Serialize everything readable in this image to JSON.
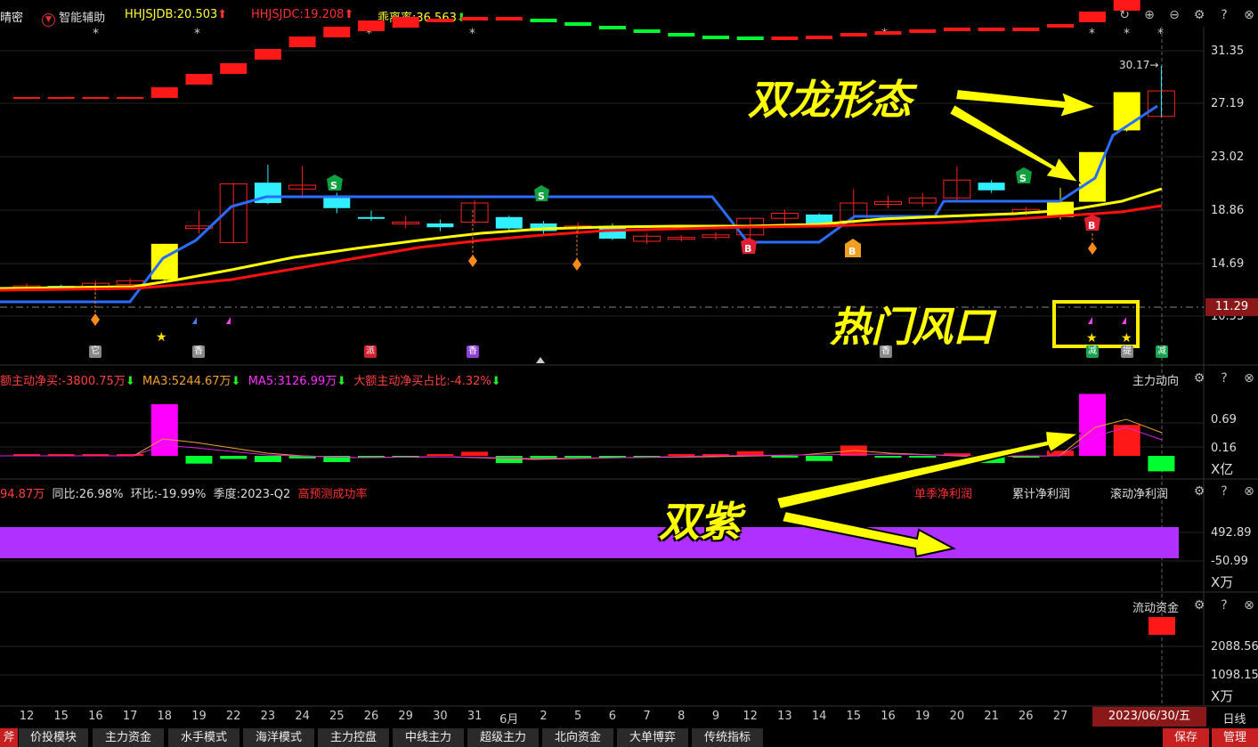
{
  "header": {
    "stock_name": "晴密",
    "assist_label": "智能辅助",
    "hhjsjdb": "HHJSJDB:20.503",
    "hhjsjdc": "HHJSJDC:19.208",
    "guaililv": "乖离率:36.563"
  },
  "main_chart": {
    "peak_label": "30.17",
    "current_price": "11.29",
    "yticks": [
      "31.35",
      "27.19",
      "23.02",
      "18.86",
      "14.69",
      "10.53"
    ]
  },
  "panel2": {
    "title_main": "额主动净买:-3800.75万",
    "title_ma3": "MA3:5244.67万",
    "title_ma5": "MA5:3126.99万",
    "title_ratio": "大额主动净买占比:-4.32%",
    "name": "主力动向",
    "yticks": [
      "0.69",
      "0.16"
    ],
    "unit": "X亿"
  },
  "panel3": {
    "title_value": "94.87万",
    "title_yoy": "同比:26.98%",
    "title_qoq": "环比:-19.99%",
    "title_quarter": "季度:2023-Q2",
    "title_rate": "高预测成功率",
    "tab_single": "单季净利润",
    "tab_cumulative": "累计净利润",
    "tab_rolling": "滚动净利润",
    "yticks": [
      "492.89",
      "-50.99"
    ],
    "unit": "X万"
  },
  "panel4": {
    "name": "流动资金",
    "yticks": [
      "2088.56",
      "1098.15"
    ],
    "unit": "X万"
  },
  "xaxis": {
    "ticks": [
      "12",
      "15",
      "16",
      "17",
      "18",
      "19",
      "22",
      "23",
      "24",
      "25",
      "26",
      "29",
      "30",
      "31",
      "6月",
      "2",
      "5",
      "6",
      "7",
      "8",
      "9",
      "12",
      "13",
      "14",
      "15",
      "16",
      "19",
      "20",
      "21",
      "26",
      "27"
    ],
    "date_label": "2023/06/30/五",
    "period_label": "日线"
  },
  "annotations": {
    "double_dragon": "双龙形态",
    "hot_wind": "热门风口",
    "double_purple": "双紫"
  },
  "signal_tags": {
    "t1": "它",
    "t2": "香",
    "t3": "派",
    "t4": "香",
    "t5": "香",
    "t6": "减",
    "t7": "提",
    "t8": "减"
  },
  "bottom_tabs": [
    "斧",
    "价投模块",
    "主力资金",
    "水手模式",
    "海洋模式",
    "主力控盘",
    "中线主力",
    "超级主力",
    "北向资金",
    "大单博弈",
    "传统指标"
  ],
  "bottom_buttons": {
    "save": "保存",
    "manage": "管理"
  },
  "colors": {
    "up": "#ff2020",
    "down": "#00ff40",
    "ma_yellow": "#ffff00",
    "ma_red": "#ff1010",
    "line_blue": "#2a6cff",
    "purple": "#b030ff",
    "magenta": "#ff00ff",
    "cyan": "#30f0ff"
  },
  "chart_data": {
    "type": "candlestick",
    "yrange": [
      10.53,
      31.35
    ],
    "candles": [
      {
        "x": "12",
        "o": 12.8,
        "c": 12.9,
        "h": 13.1,
        "l": 12.7
      },
      {
        "x": "15",
        "o": 12.9,
        "c": 12.8,
        "h": 13.0,
        "l": 12.6
      },
      {
        "x": "16",
        "o": 12.8,
        "c": 13.1,
        "h": 13.3,
        "l": 12.5
      },
      {
        "x": "17",
        "o": 13.0,
        "c": 13.3,
        "h": 13.5,
        "l": 12.8
      },
      {
        "x": "18",
        "o": 13.4,
        "c": 16.2,
        "h": 16.2,
        "l": 13.3
      },
      {
        "x": "19",
        "o": 17.4,
        "c": 17.6,
        "h": 18.8,
        "l": 17.0
      },
      {
        "x": "22",
        "o": 16.3,
        "c": 20.9,
        "h": 21.0,
        "l": 16.3
      },
      {
        "x": "23",
        "o": 21.0,
        "c": 19.4,
        "h": 22.4,
        "l": 19.3
      },
      {
        "x": "24",
        "o": 20.5,
        "c": 20.8,
        "h": 22.3,
        "l": 20.0
      },
      {
        "x": "25",
        "o": 20.0,
        "c": 19.0,
        "h": 20.2,
        "l": 18.6
      },
      {
        "x": "26",
        "o": 18.3,
        "c": 18.2,
        "h": 18.8,
        "l": 18.0
      },
      {
        "x": "29",
        "o": 17.9,
        "c": 17.9,
        "h": 18.4,
        "l": 17.4
      },
      {
        "x": "30",
        "o": 17.8,
        "c": 17.5,
        "h": 18.1,
        "l": 17.2
      },
      {
        "x": "31",
        "o": 17.9,
        "c": 19.4,
        "h": 19.6,
        "l": 17.8
      },
      {
        "x": "6月",
        "o": 18.3,
        "c": 17.4,
        "h": 18.4,
        "l": 17.1
      },
      {
        "x": "2",
        "o": 17.8,
        "c": 17.2,
        "h": 18.0,
        "l": 17.0
      },
      {
        "x": "5",
        "o": 17.4,
        "c": 17.6,
        "h": 17.9,
        "l": 17.0
      },
      {
        "x": "6",
        "o": 17.6,
        "c": 16.6,
        "h": 17.8,
        "l": 16.5
      },
      {
        "x": "7",
        "o": 16.4,
        "c": 16.8,
        "h": 17.0,
        "l": 16.2
      },
      {
        "x": "8",
        "o": 16.6,
        "c": 16.7,
        "h": 16.9,
        "l": 16.4
      },
      {
        "x": "9",
        "o": 16.7,
        "c": 16.9,
        "h": 17.1,
        "l": 16.5
      },
      {
        "x": "12",
        "o": 16.9,
        "c": 18.2,
        "h": 18.3,
        "l": 16.2
      },
      {
        "x": "13",
        "o": 18.2,
        "c": 18.6,
        "h": 18.9,
        "l": 17.6
      },
      {
        "x": "14",
        "o": 18.5,
        "c": 17.8,
        "h": 18.6,
        "l": 17.5
      },
      {
        "x": "15",
        "o": 18.0,
        "c": 19.4,
        "h": 20.5,
        "l": 17.7
      },
      {
        "x": "16",
        "o": 19.3,
        "c": 19.5,
        "h": 20.0,
        "l": 19.0
      },
      {
        "x": "19",
        "o": 19.4,
        "c": 19.8,
        "h": 20.2,
        "l": 19.1
      },
      {
        "x": "20",
        "o": 19.8,
        "c": 21.2,
        "h": 22.3,
        "l": 19.6
      },
      {
        "x": "21",
        "o": 21.0,
        "c": 20.4,
        "h": 21.2,
        "l": 20.2
      },
      {
        "x": "26",
        "o": 18.6,
        "c": 18.9,
        "h": 19.1,
        "l": 18.4
      },
      {
        "x": "27",
        "o": 18.3,
        "c": 19.5,
        "h": 20.6,
        "l": 18.1
      },
      {
        "x": "28",
        "o": 19.5,
        "c": 23.4,
        "h": 23.4,
        "l": 19.5
      },
      {
        "x": "29",
        "o": 25.1,
        "c": 28.1,
        "h": 28.1,
        "l": 25.0
      },
      {
        "x": "30",
        "o": 28.2,
        "c": 26.2,
        "h": 30.17,
        "l": 26.1
      }
    ]
  }
}
